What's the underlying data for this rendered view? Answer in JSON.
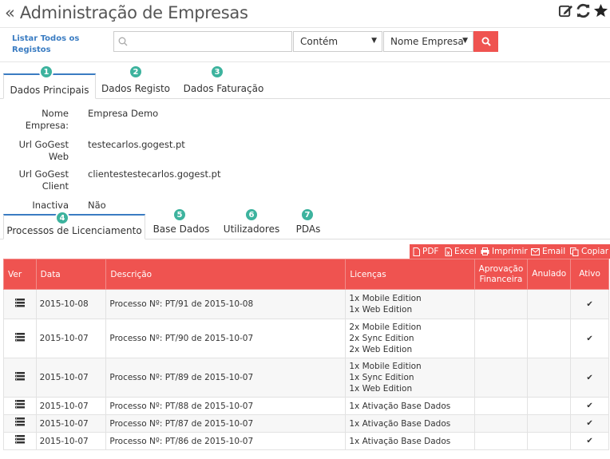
{
  "header": {
    "title": "« Administração de Empresas"
  },
  "search": {
    "list_all_label": "Listar Todos os Registos",
    "placeholder": "",
    "operator": "Contém",
    "field": "Nome Empresa"
  },
  "tabs_top": [
    {
      "label": "Dados Principais",
      "badge": "1"
    },
    {
      "label": "Dados Registo",
      "badge": "2"
    },
    {
      "label": "Dados Faturação",
      "badge": "3"
    }
  ],
  "form": {
    "nome_label": "Nome Empresa:",
    "nome_value": "Empresa Demo",
    "url_web_label": "Url GoGest Web",
    "url_web_value": "testecarlos.gogest.pt",
    "url_client_label": "Url GoGest Client",
    "url_client_value": "clientestestecarlos.gogest.pt",
    "inactiva_label": "Inactiva",
    "inactiva_value": "Não"
  },
  "tabs_bottom": [
    {
      "label": "Processos de Licenciamento",
      "badge": "4"
    },
    {
      "label": "Base Dados",
      "badge": "5"
    },
    {
      "label": "Utilizadores",
      "badge": "6"
    },
    {
      "label": "PDAs",
      "badge": "7"
    }
  ],
  "export": {
    "pdf": "PDF",
    "excel": "Excel",
    "print": "Imprimir",
    "email": "Email",
    "copy": "Copiar"
  },
  "table": {
    "columns": {
      "ver": "Ver",
      "data": "Data",
      "descricao": "Descrição",
      "licencas": "Licenças",
      "aprovacao": "Aprovação Financeira",
      "anulado": "Anulado",
      "ativo": "Ativo"
    },
    "rows": [
      {
        "data": "2015-10-08",
        "descricao": "Processo Nº: PT/91 de 2015-10-08",
        "licencas": [
          "1x Mobile Edition",
          "1x Web Edition"
        ],
        "ativo": "✔"
      },
      {
        "data": "2015-10-07",
        "descricao": "Processo Nº: PT/90 de 2015-10-07",
        "licencas": [
          "2x Mobile Edition",
          "2x Sync Edition",
          "2x Web Edition"
        ],
        "ativo": "✔"
      },
      {
        "data": "2015-10-07",
        "descricao": "Processo Nº: PT/89 de 2015-10-07",
        "licencas": [
          "1x Mobile Edition",
          "1x Sync Edition",
          "1x Web Edition"
        ],
        "ativo": "✔"
      },
      {
        "data": "2015-10-07",
        "descricao": "Processo Nº: PT/88 de 2015-10-07",
        "licencas": [
          "1x Ativação Base Dados"
        ],
        "ativo": "✔"
      },
      {
        "data": "2015-10-07",
        "descricao": "Processo Nº: PT/87 de 2015-10-07",
        "licencas": [
          "1x Ativação Base Dados"
        ],
        "ativo": "✔"
      },
      {
        "data": "2015-10-07",
        "descricao": "Processo Nº: PT/86 de 2015-10-07",
        "licencas": [
          "1x Ativação Base Dados"
        ],
        "ativo": "✔"
      }
    ]
  },
  "colors": {
    "accent_red": "#ef5350",
    "badge_teal": "#3db39e",
    "link_blue": "#3a7cc2"
  },
  "icons": {
    "edit": "edit-icon",
    "refresh": "refresh-icon",
    "favorite": "star-icon",
    "search": "search-icon",
    "row_view": "list-icon"
  }
}
